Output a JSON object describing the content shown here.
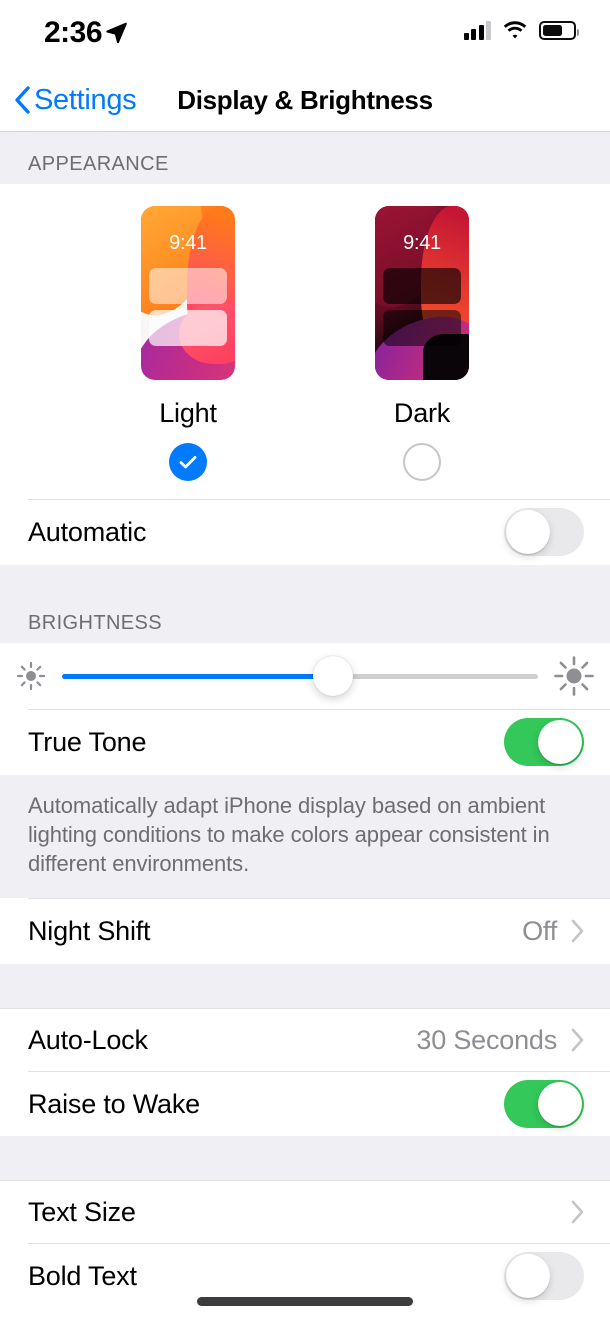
{
  "status_bar": {
    "time": "2:36",
    "location_icon": "location-arrow-icon",
    "cellular_icon": "cellular-signal-icon",
    "wifi_icon": "wifi-icon",
    "battery_icon": "battery-icon",
    "battery_fill_percent": 62
  },
  "nav": {
    "back_label": "Settings",
    "back_icon": "chevron-left-icon",
    "title": "Display & Brightness"
  },
  "appearance": {
    "header": "APPEARANCE",
    "options": [
      {
        "name": "Light",
        "preview_time": "9:41",
        "selected": true
      },
      {
        "name": "Dark",
        "preview_time": "9:41",
        "selected": false
      }
    ],
    "automatic": {
      "label": "Automatic",
      "toggle_state": "off"
    }
  },
  "brightness": {
    "header": "BRIGHTNESS",
    "low_icon": "sun-min-icon",
    "high_icon": "sun-max-icon",
    "slider_percent": 57,
    "true_tone": {
      "label": "True Tone",
      "toggle_state": "on"
    },
    "true_tone_note": "Automatically adapt iPhone display based on ambient lighting conditions to make colors appear consistent in different environments.",
    "night_shift": {
      "label": "Night Shift",
      "value": "Off",
      "chevron_icon": "chevron-right-icon"
    }
  },
  "lock": {
    "auto_lock": {
      "label": "Auto-Lock",
      "value": "30 Seconds",
      "chevron_icon": "chevron-right-icon"
    },
    "raise_to_wake": {
      "label": "Raise to Wake",
      "toggle_state": "on"
    }
  },
  "text": {
    "text_size": {
      "label": "Text Size",
      "value": "",
      "chevron_icon": "chevron-right-icon"
    },
    "bold_text": {
      "label": "Bold Text",
      "toggle_state": "off"
    }
  },
  "colors": {
    "accent_blue": "#007aff",
    "toggle_on_green": "#34c759",
    "toggle_off_gray": "#e9e9eb",
    "group_background": "#efeff4",
    "secondary_text": "#8e8e93",
    "header_text": "#6d6d72"
  }
}
